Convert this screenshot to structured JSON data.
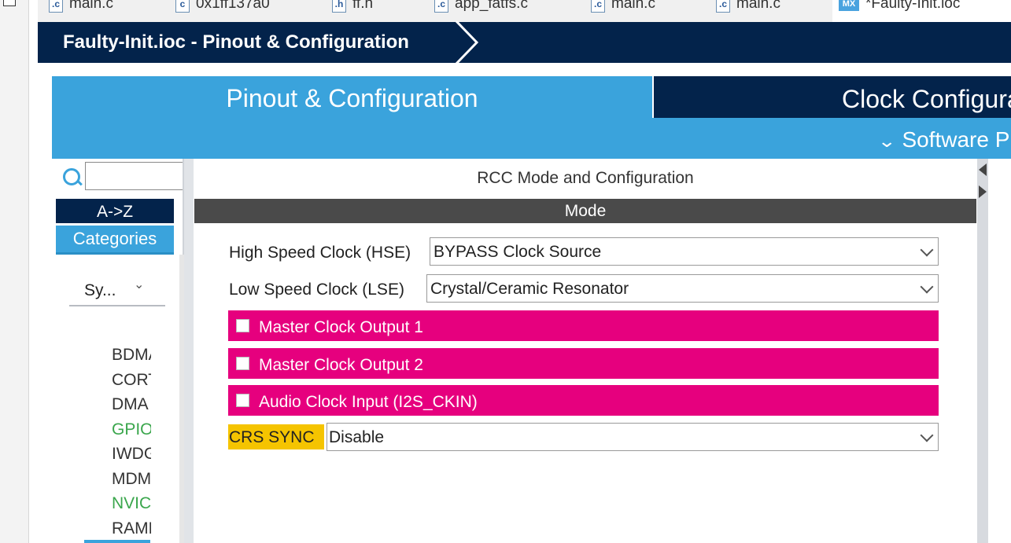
{
  "tabs": [
    {
      "label": "main.c",
      "icon": "c-file-icon",
      "glyph": ".c"
    },
    {
      "label": "0x1ff137a0",
      "icon": "c-file-icon",
      "glyph": "c"
    },
    {
      "label": "ff.h",
      "icon": "h-file-icon",
      "glyph": ".h"
    },
    {
      "label": "app_fatfs.c",
      "icon": "c-file-icon",
      "glyph": ".c"
    },
    {
      "label": "main.c",
      "icon": "c-file-icon",
      "glyph": ".c"
    },
    {
      "label": "main.c",
      "icon": "c-file-icon",
      "glyph": ".c"
    },
    {
      "label": "*Faulty-Init.ioc",
      "icon": "mx-file-icon",
      "glyph": "MX"
    }
  ],
  "header": {
    "title": "Faulty-Init.ioc - Pinout & Configuration"
  },
  "main_tabs": {
    "pinout": "Pinout & Configuration",
    "clock": "Clock Configura"
  },
  "subbar": {
    "software_label": "Software P"
  },
  "sidebar": {
    "search_value": "",
    "az_label": "A->Z",
    "categories_label": "Categories",
    "group_select": "Sy...",
    "items": [
      {
        "label": "BDMA",
        "enabled": false
      },
      {
        "label": "CORTEX",
        "enabled": false
      },
      {
        "label": "DMA",
        "enabled": false
      },
      {
        "label": "GPIO",
        "enabled": true
      },
      {
        "label": "IWDG",
        "enabled": false
      },
      {
        "label": "MDMA",
        "enabled": false
      },
      {
        "label": "NVIC",
        "enabled": true
      },
      {
        "label": "RAMECC",
        "enabled": false
      }
    ]
  },
  "rcc": {
    "title": "RCC Mode and Configuration",
    "mode_header": "Mode",
    "hse_label": "High Speed Clock (HSE)",
    "hse_value": "BYPASS Clock Source",
    "lse_label": "Low Speed Clock (LSE)",
    "lse_value": "Crystal/Ceramic Resonator",
    "mco1_label": "Master Clock Output 1",
    "mco2_label": "Master Clock Output 2",
    "i2s_label": "Audio Clock Input (I2S_CKIN)",
    "crs_label": "CRS SYNC",
    "crs_value": "Disable"
  },
  "colors": {
    "navy": "#03234b",
    "blue": "#3aa3dc",
    "pink": "#e6007e",
    "yellow": "#f5c400",
    "green": "#3aa64c"
  }
}
